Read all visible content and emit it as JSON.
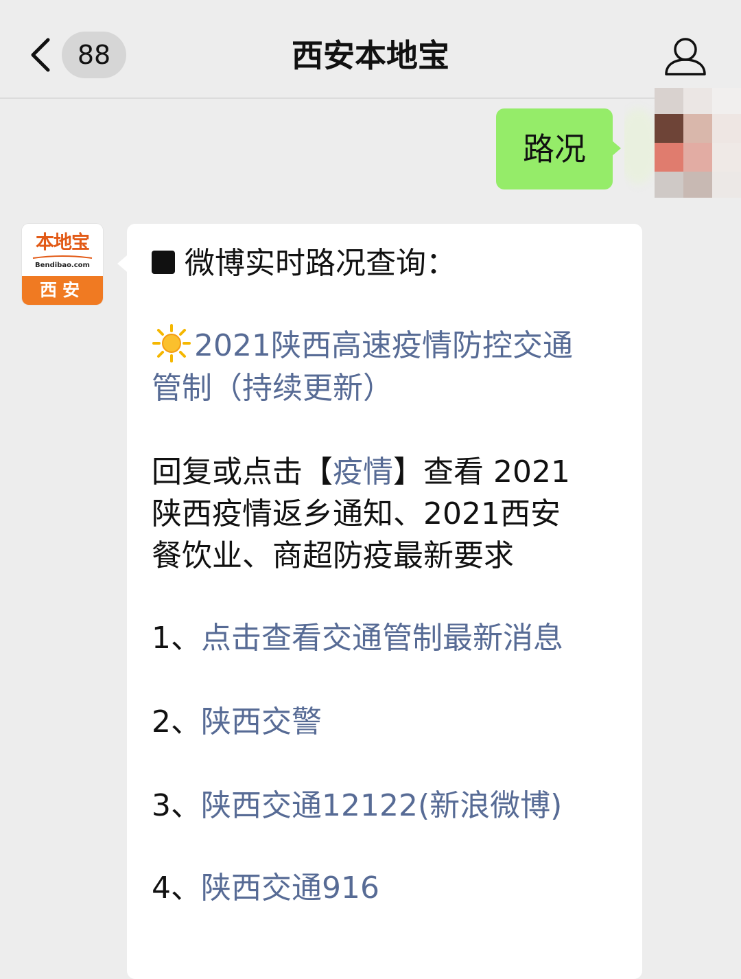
{
  "nav": {
    "title": "西安本地宝",
    "unread_count": "88"
  },
  "outgoing": {
    "text": "路况"
  },
  "bot": {
    "logo_cn": "本地宝",
    "logo_en": "Bendibao.com",
    "logo_city": "西安"
  },
  "message": {
    "heading": "微博实时路况查询：",
    "notice_link": "2021陕西高速疫情防控交通管制（持续更新）",
    "notice_link_line1": "2021陕西高速疫情防控交通",
    "notice_link_line2": "管制（持续更新）",
    "reply_prefix": "回复或点击【",
    "reply_keyword": "疫情",
    "reply_suffix": "】查看",
    "reply_year": "2021",
    "reply_line2": "陕西疫情返乡通知、2021西安",
    "reply_line3": "餐饮业、商超防疫最新要求",
    "items": [
      {
        "num": "1、",
        "label": "点击查看交通管制最新消息"
      },
      {
        "num": "2、",
        "label": "陕西交警"
      },
      {
        "num": "3、",
        "label": "陕西交通12122(新浪微博)"
      },
      {
        "num": "4、",
        "label": "陕西交通916"
      }
    ]
  },
  "colors": {
    "link": "#576b95",
    "outgoing_bubble": "#95ec69",
    "background": "#ededed"
  }
}
